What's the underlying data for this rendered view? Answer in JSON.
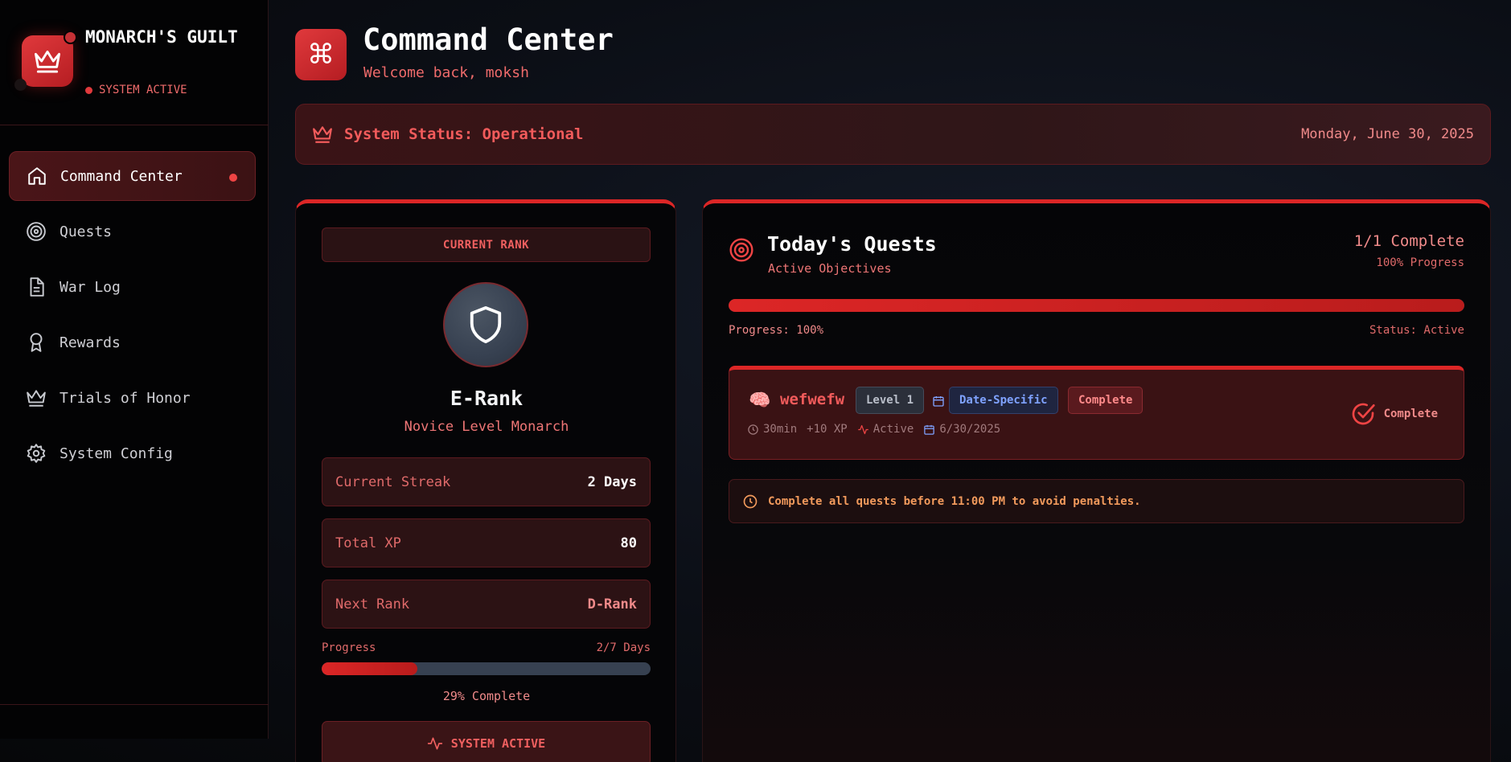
{
  "brand": {
    "title": "MONARCH'S GUILT",
    "status": "SYSTEM ACTIVE"
  },
  "nav": {
    "items": [
      {
        "label": "Command Center",
        "icon": "home-icon",
        "active": true
      },
      {
        "label": "Quests",
        "icon": "target-icon"
      },
      {
        "label": "War Log",
        "icon": "document-icon"
      },
      {
        "label": "Rewards",
        "icon": "award-icon"
      },
      {
        "label": "Trials of Honor",
        "icon": "crown-icon"
      },
      {
        "label": "System Config",
        "icon": "gear-icon"
      }
    ]
  },
  "header": {
    "icon": "command-icon",
    "title": "Command Center",
    "subtitle": "Welcome back, moksh"
  },
  "status_bar": {
    "text": "System Status: Operational",
    "date": "Monday, June 30, 2025"
  },
  "rank_card": {
    "label": "CURRENT RANK",
    "rank": "E-Rank",
    "rank_title": "Novice Level Monarch",
    "stats": [
      {
        "label": "Current Streak",
        "value": "2 Days"
      },
      {
        "label": "Total XP",
        "value": "80"
      },
      {
        "label": "Next Rank",
        "value": "D-Rank"
      }
    ],
    "progress_label": "Progress",
    "progress_days": "2/7 Days",
    "progress_fraction": 0.29,
    "progress_caption": "29% Complete",
    "button_label": "SYSTEM ACTIVE"
  },
  "quests": {
    "title": "Today's Quests",
    "subtitle": "Active Objectives",
    "count": "1/1 Complete",
    "percent": "100% Progress",
    "progress_fraction": 1.0,
    "progress_label": "Progress: 100%",
    "status_label": "Status: Active",
    "items": [
      {
        "emoji": "🧠",
        "name": "wefwefw",
        "level": "Level 1",
        "type": "Date-Specific",
        "state": "Complete",
        "duration": "30min",
        "xp": "+10 XP",
        "activity": "Active",
        "date": "6/30/2025",
        "action_label": "Complete"
      }
    ],
    "deadline": "Complete all quests before 11:00 PM to avoid penalties."
  },
  "colors": {
    "accent": "#dc2626",
    "accent_text": "#f25b5b",
    "warning": "#f29a5c",
    "info": "#7fa2ff"
  }
}
